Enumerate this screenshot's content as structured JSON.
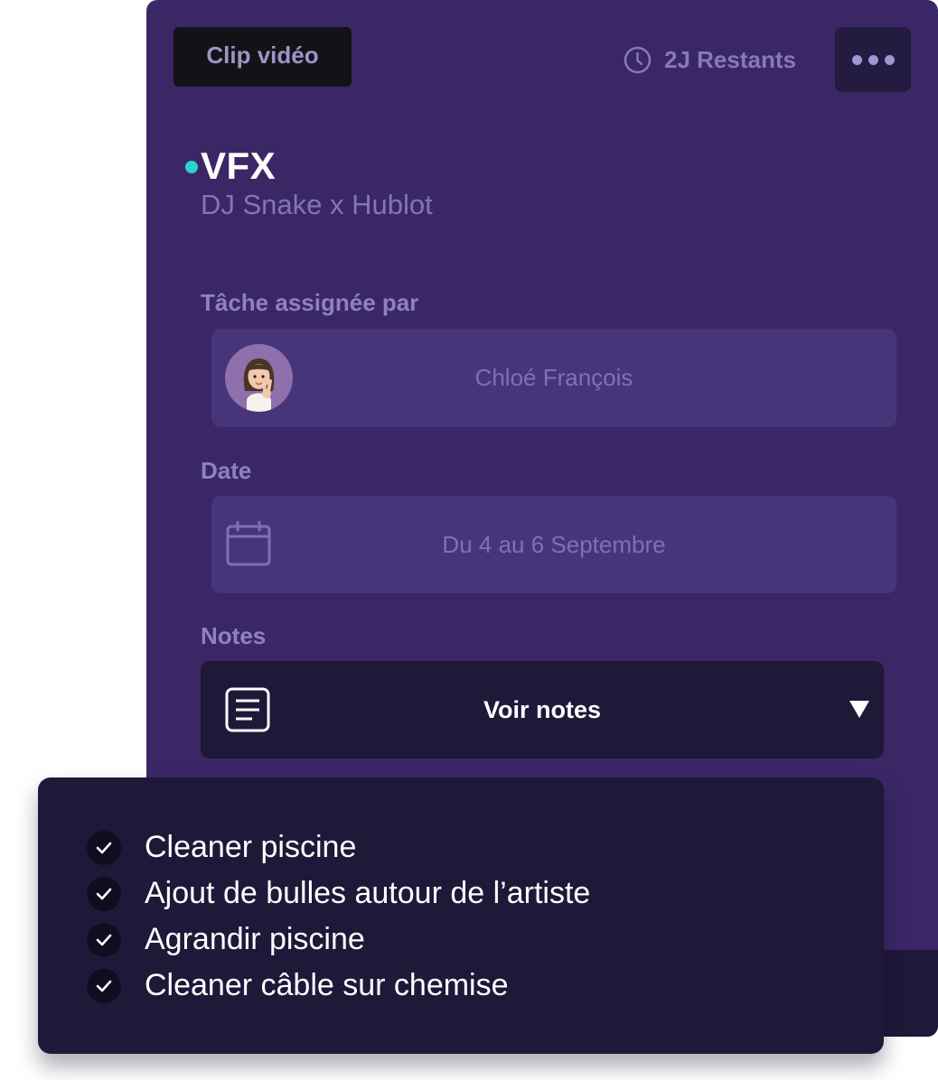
{
  "card": {
    "tag_label": "Clip vidéo",
    "remaining_label": "2J Restants",
    "title": "VFX",
    "subtitle": "DJ Snake x Hublot",
    "status_color": "#2bd1cf"
  },
  "assigned": {
    "label": "Tâche assignée par",
    "name": "Chloé François"
  },
  "date": {
    "label": "Date",
    "value": "Du 4 au 6 Septembre"
  },
  "notes": {
    "label": "Notes",
    "toggle_label": "Voir notes",
    "items": [
      "Cleaner piscine",
      "Ajout de bulles autour de l’artiste",
      "Agrandir piscine",
      "Cleaner câble sur chemise"
    ]
  },
  "icons": {
    "remaining": "clock-icon",
    "more": "more-dots-icon",
    "date": "calendar-icon",
    "notes": "document-icon",
    "toggle": "caret-down-icon",
    "note_status": "check-icon"
  },
  "colors": {
    "card_bg": "#3b2766",
    "field_bg": "#47357a",
    "panel_bg": "#1f1838",
    "accent": "#2bd1cf"
  }
}
